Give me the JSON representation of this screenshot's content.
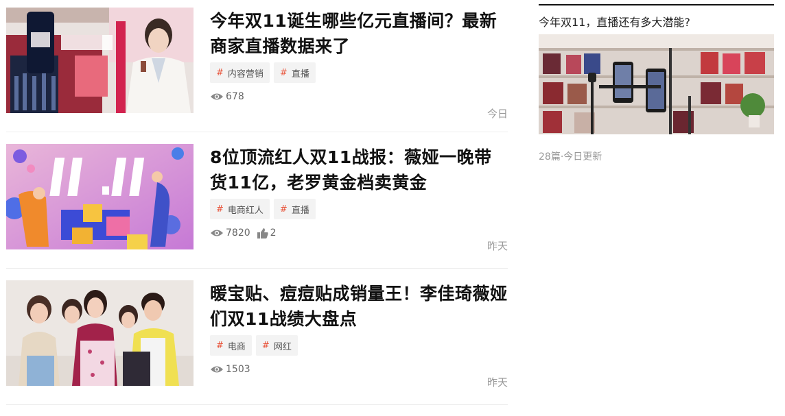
{
  "articles": [
    {
      "title": "今年双11诞生哪些亿元直播间？最新商家直播数据来了",
      "image_icon": "lancome-livestream-photo",
      "tags": [
        "内容营销",
        "直播"
      ],
      "views": "678",
      "likes": null,
      "date": "今日"
    },
    {
      "title": "8位顶流红人双11战报：薇娅一晚带货11亿，老罗黄金档卖黄金",
      "image_icon": "double-eleven-illustration",
      "tags": [
        "电商红人",
        "直播"
      ],
      "views": "7820",
      "likes": "2",
      "date": "昨天"
    },
    {
      "title": "暖宝贴、痘痘贴成销量王！李佳琦薇娅们双11战绩大盘点",
      "image_icon": "influencers-group-photo",
      "tags": [
        "电商",
        "网红"
      ],
      "views": "1503",
      "likes": null,
      "date": "昨天"
    }
  ],
  "sidebar": {
    "title": "今年双11，直播还有多大潜能?",
    "image_icon": "phone-livestream-setup-photo",
    "meta": "28篇·今日更新"
  },
  "colors": {
    "tag_hash": "#e8533a",
    "tag_bg": "#f3f3f3",
    "meta_gray": "#999999"
  }
}
